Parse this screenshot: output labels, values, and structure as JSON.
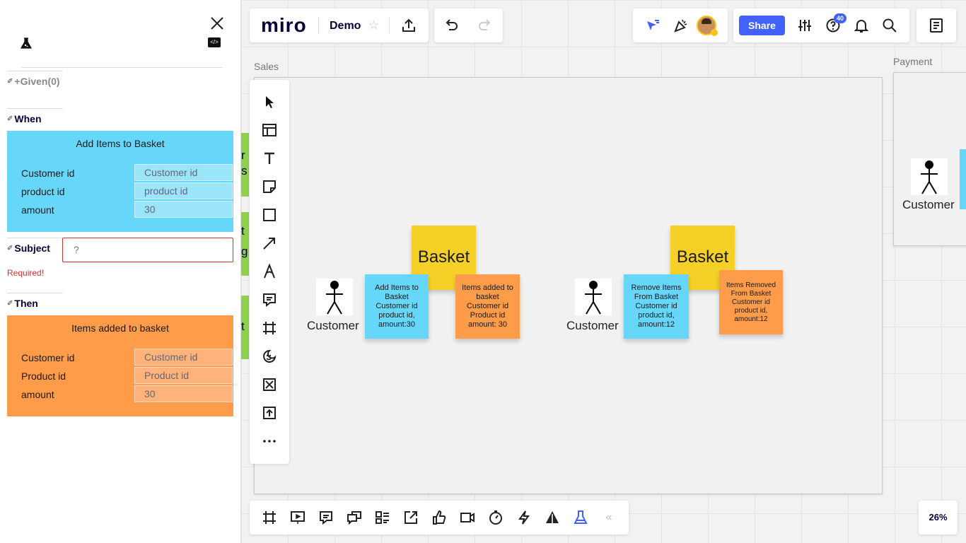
{
  "side_panel": {
    "given_label": "+Given(0)",
    "when_label": "When",
    "when_card": {
      "title": "Add Items to Basket",
      "fields": [
        {
          "label": "Customer id",
          "placeholder": "Customer id",
          "value": ""
        },
        {
          "label": "product id",
          "placeholder": "product id",
          "value": ""
        },
        {
          "label": "amount",
          "placeholder": "",
          "value": "30"
        }
      ]
    },
    "subject_label": "Subject",
    "subject_placeholder": "?",
    "required_text": "Required!",
    "then_label": "Then",
    "then_card": {
      "title": "Items added to basket",
      "fields": [
        {
          "label": "Customer id",
          "placeholder": "Customer id",
          "value": ""
        },
        {
          "label": "Product id",
          "placeholder": "Product id",
          "value": ""
        },
        {
          "label": "amount",
          "placeholder": "",
          "value": "30"
        }
      ]
    }
  },
  "topbar": {
    "logo": "miro",
    "board_name": "Demo",
    "share_label": "Share",
    "notification_count": "40"
  },
  "canvas": {
    "frames": [
      {
        "label": "Sales"
      },
      {
        "label": "Payment"
      }
    ],
    "partial_left_texts": [
      "r",
      "s",
      "t",
      "g",
      "t"
    ],
    "actors": [
      {
        "label": "Customer"
      },
      {
        "label": "Customer"
      },
      {
        "label": "Customer"
      }
    ],
    "stickies": [
      {
        "text": "Basket",
        "color": "#f5d128"
      },
      {
        "text": "Add Items to\nBasket\nCustomer id\nproduct id,\namount:30",
        "color": "#67d7f9"
      },
      {
        "text": "Items added to\nbasket\nCustomer id\nProduct id\namount: 30",
        "color": "#fe9c4a"
      },
      {
        "text": "Basket",
        "color": "#f5d128"
      },
      {
        "text": "Remove Items\nFrom Basket\nCustomer id\nproduct id,\namount:12",
        "color": "#67d7f9"
      },
      {
        "text": "Items Removed\nFrom Basket\nCustomer id\nproduct id,\namount:12",
        "color": "#fe9c4a"
      }
    ]
  },
  "zoom": "26%",
  "left_tools": [
    "select-arrow-icon",
    "templates-icon",
    "text-icon",
    "sticky-note-icon",
    "shape-icon",
    "connection-line-icon",
    "pen-icon",
    "comment-icon",
    "frame-icon",
    "emoji-sticker-icon",
    "close-box-icon",
    "upload-icon",
    "more-icon"
  ],
  "bottom_tools": [
    "frames-icon",
    "presentation-icon",
    "comments-icon",
    "chat-icon",
    "cards-icon",
    "share-screen-icon",
    "voting-icon",
    "video-icon",
    "timer-icon",
    "lightning-icon",
    "event-storming-icon",
    "lab-flask-icon"
  ]
}
